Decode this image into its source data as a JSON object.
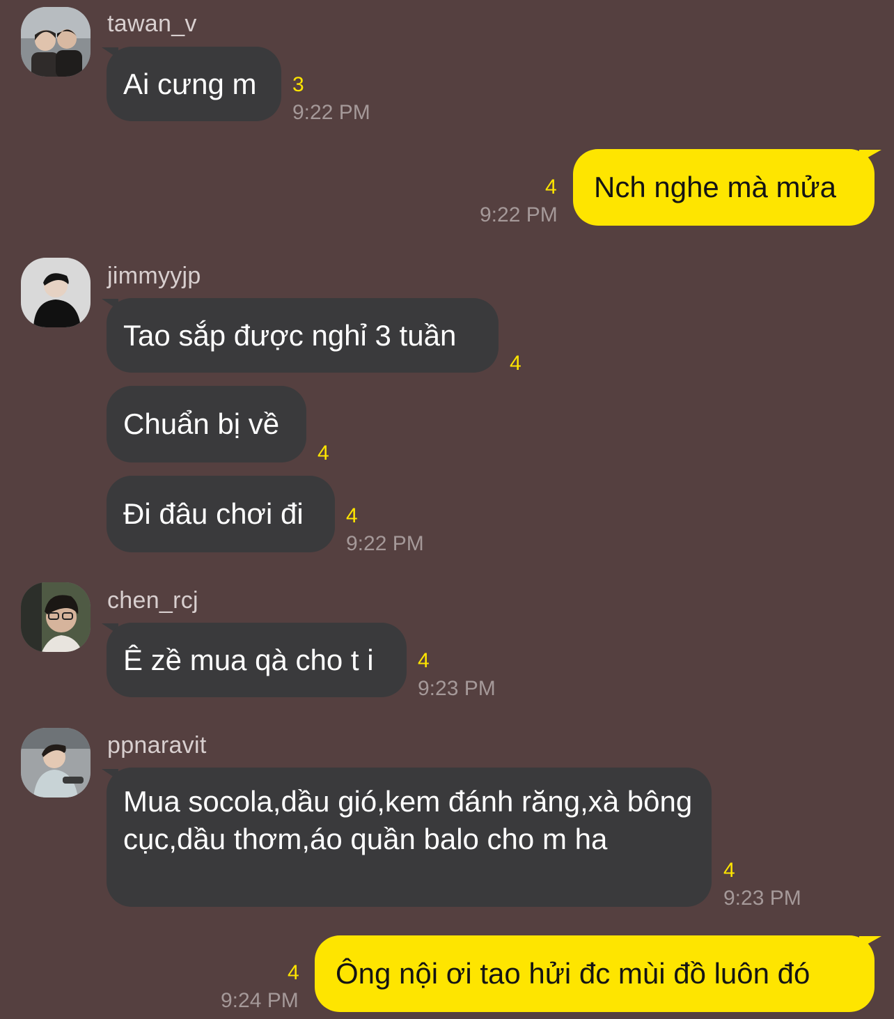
{
  "colors": {
    "background": "#554040",
    "incoming_bubble": "#3a3a3c",
    "outgoing_bubble": "#fee500",
    "unread_count": "#fee500",
    "timestamp": "#a59999"
  },
  "messages": [
    {
      "sender": "tawan_v",
      "avatar": "profile-photo-icon",
      "text": "Ai cưng m",
      "unread": "3",
      "time": "9:22 PM"
    },
    {
      "sender": "me",
      "text": "Nch nghe mà mửa",
      "unread": "4",
      "time": "9:22 PM"
    },
    {
      "sender": "jimmyyjp",
      "avatar": "profile-photo-icon",
      "text": "Tao sắp được nghỉ 3 tuần",
      "unread": "4"
    },
    {
      "sender": "jimmyyjp",
      "text": "Chuẩn bị về",
      "unread": "4"
    },
    {
      "sender": "jimmyyjp",
      "text": "Đi đâu chơi đi",
      "unread": "4",
      "time": "9:22 PM"
    },
    {
      "sender": "chen_rcj",
      "avatar": "profile-photo-icon",
      "text": "Ê zề mua qà cho t i",
      "unread": "4",
      "time": "9:23 PM"
    },
    {
      "sender": "ppnaravit",
      "avatar": "profile-photo-icon",
      "text": "Mua socola,dầu gió,kem đánh răng,xà bông cục,dầu thơm,áo quần balo cho m ha",
      "unread": "4",
      "time": "9:23 PM"
    },
    {
      "sender": "me",
      "text": "Ông nội ơi tao hửi đc mùi đồ luôn đó",
      "unread": "4",
      "time": "9:24 PM"
    }
  ]
}
